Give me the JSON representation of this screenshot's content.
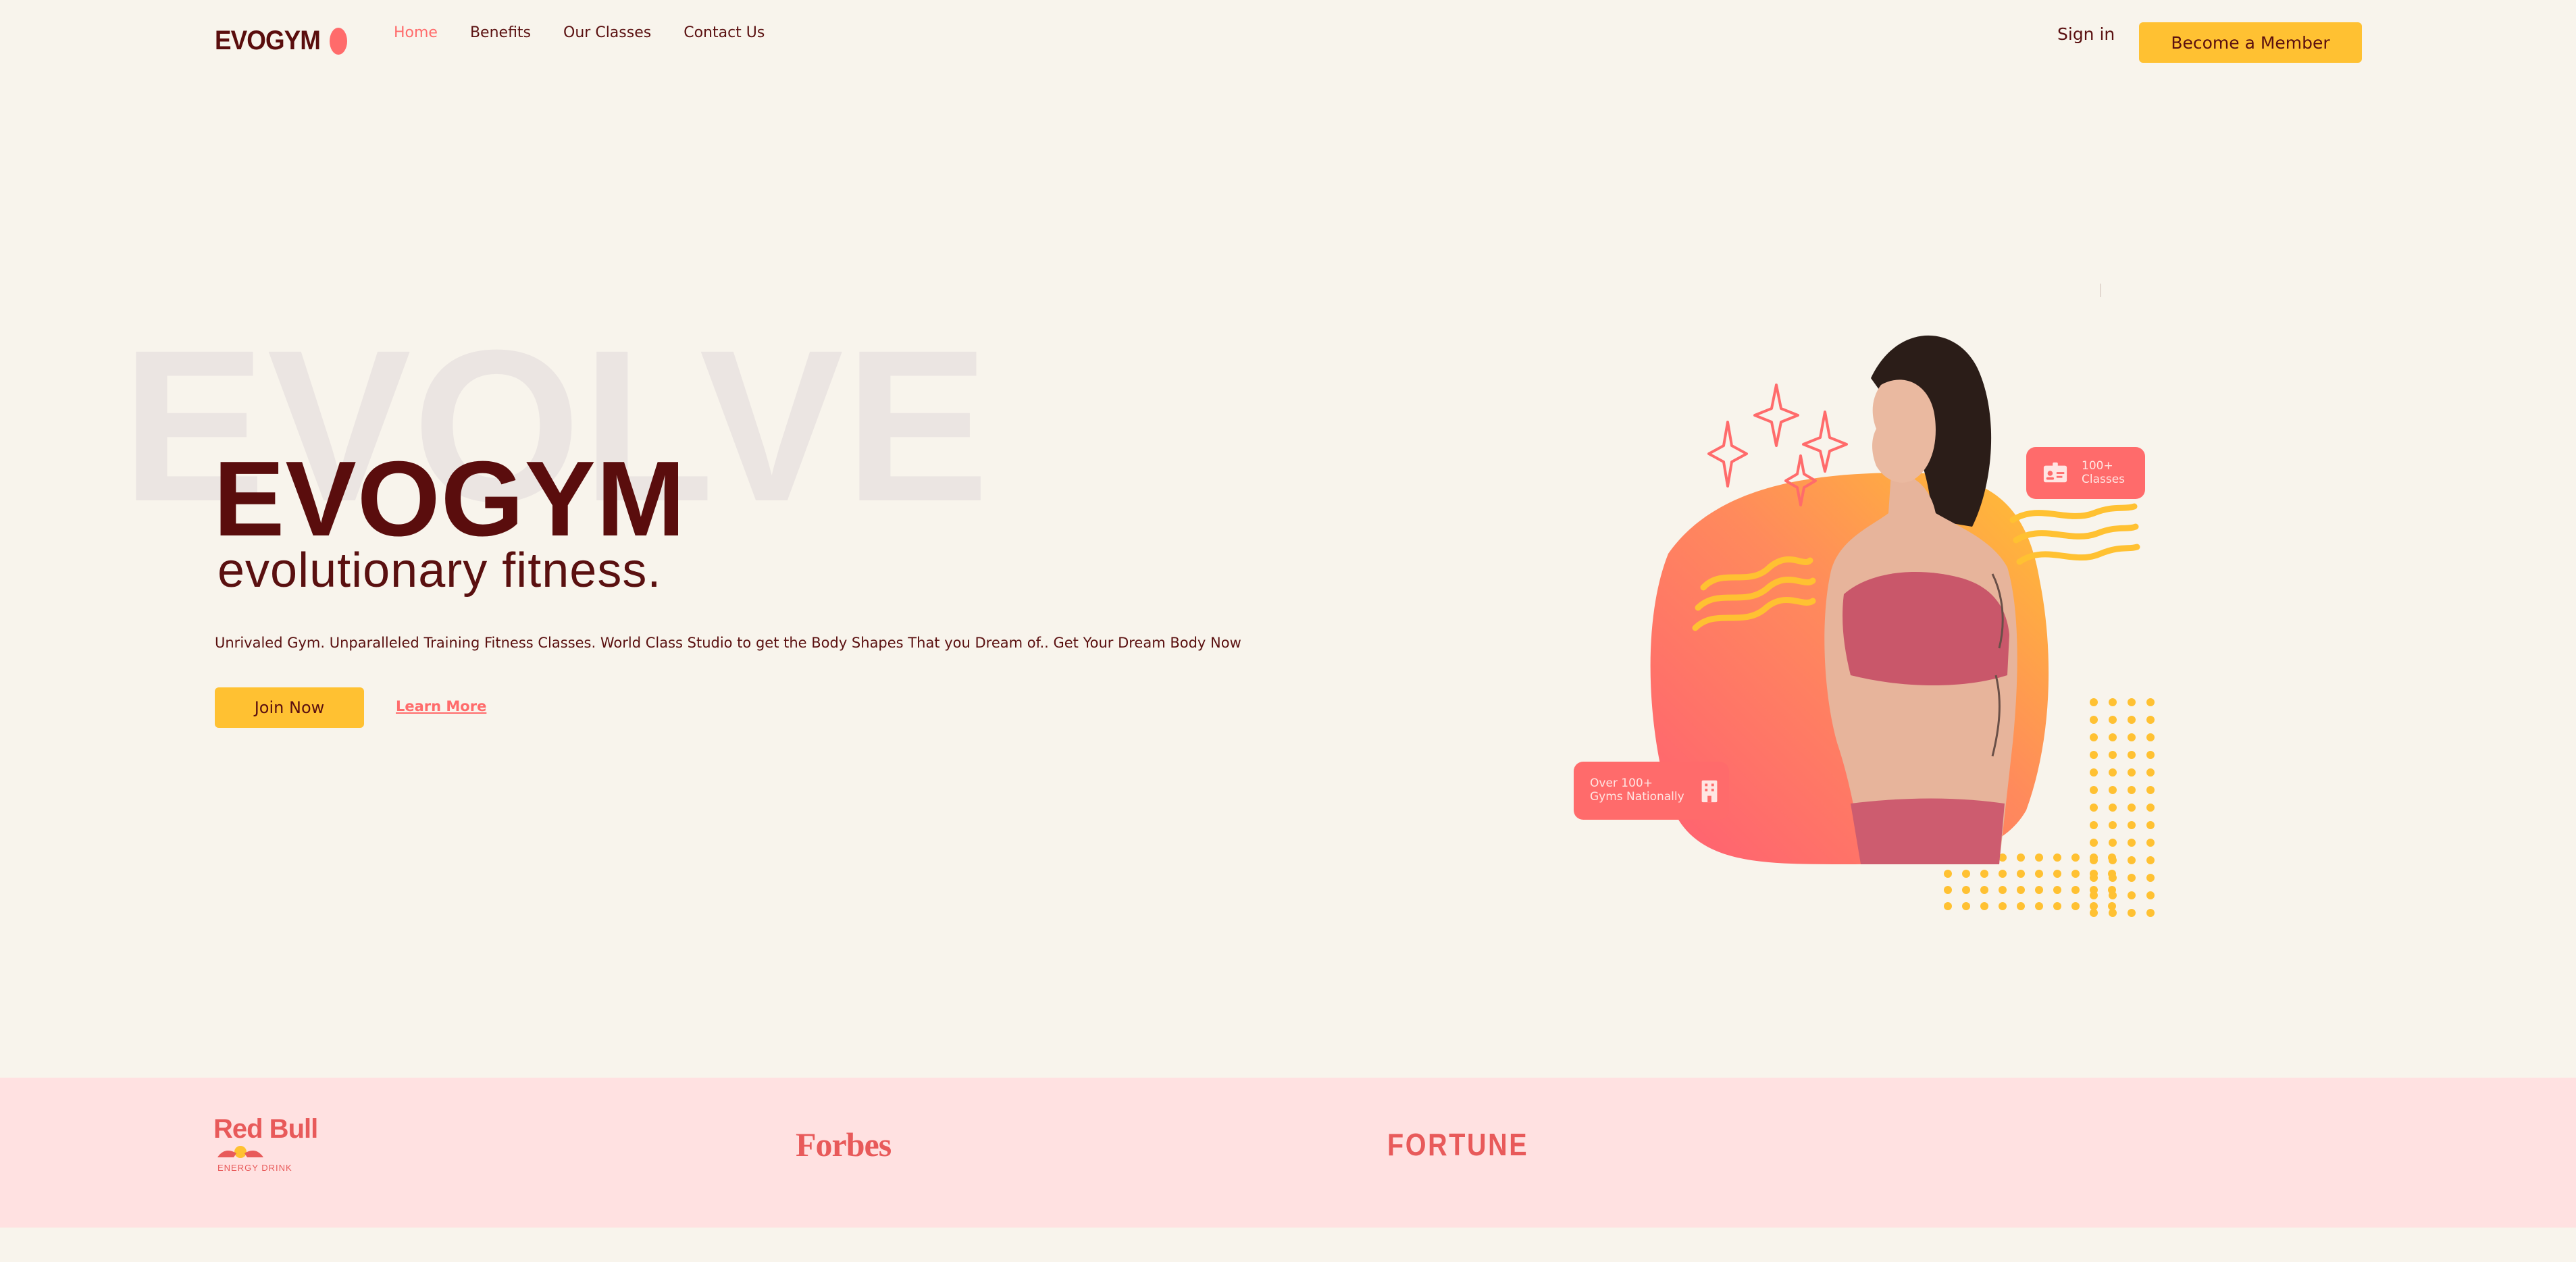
{
  "brand": {
    "logo_text": "EVOGYM"
  },
  "nav": {
    "links": [
      {
        "label": "Home",
        "active": true
      },
      {
        "label": "Benefits",
        "active": false
      },
      {
        "label": "Our Classes",
        "active": false
      },
      {
        "label": "Contact Us",
        "active": false
      }
    ],
    "sign_in": "Sign in",
    "cta": "Become a Member"
  },
  "hero": {
    "background_word": "EVOLVE",
    "title": "EVOGYM",
    "subtitle": "evolutionary fitness.",
    "description": "Unrivaled Gym. Unparalleled Training Fitness Classes. World Class Studio to get the Body Shapes That you Dream of.. Get Your Dream Body Now",
    "primary_button": "Join Now",
    "secondary_link": "Learn More"
  },
  "badges": {
    "classes": {
      "line1": "100+",
      "line2": "Classes",
      "icon": "id-card-icon"
    },
    "gyms": {
      "line1": "Over 100+",
      "line2": "Gyms Nationally",
      "icon": "building-icon"
    }
  },
  "sponsors": {
    "redbull": {
      "name": "Red Bull",
      "tagline": "ENERGY DRINK"
    },
    "forbes": {
      "name": "Forbes"
    },
    "fortune": {
      "name": "FORTUNE"
    }
  },
  "colors": {
    "background": "#f8f4ec",
    "primary_dark": "#5a0d0d",
    "accent_red": "#ff6b6b",
    "accent_yellow": "#ffc132",
    "sponsor_band": "#ffe1e1"
  }
}
